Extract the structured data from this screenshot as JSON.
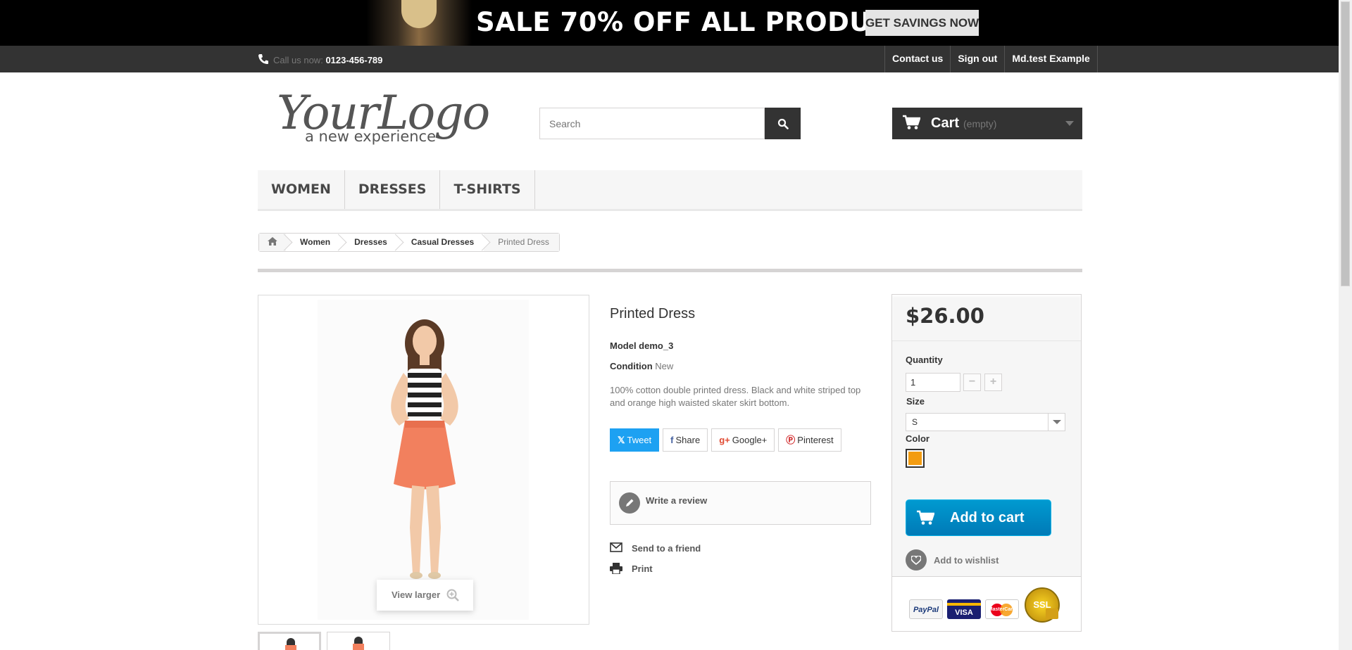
{
  "banner": {
    "headline": "SALE 70% OFF ALL PRODUCTS",
    "cta": "GET SAVINGS NOW"
  },
  "topbar": {
    "call_label": "Call us now:",
    "phone": "0123-456-789",
    "links": [
      "Contact us",
      "Sign out",
      "Md.test Example"
    ]
  },
  "logo": {
    "main": "YourLogo",
    "tagline": "a new experience"
  },
  "search": {
    "placeholder": "Search"
  },
  "cart": {
    "label": "Cart",
    "status": "(empty)"
  },
  "menu": [
    "WOMEN",
    "DRESSES",
    "T-SHIRTS"
  ],
  "breadcrumb": [
    "Women",
    "Dresses",
    "Casual Dresses",
    "Printed Dress"
  ],
  "product": {
    "title": "Printed Dress",
    "model": "Model demo_3",
    "condition_label": "Condition",
    "condition_value": "New",
    "description": "100% cotton double printed dress. Black and white striped top and orange high waisted skater skirt bottom.",
    "view_larger": "View larger"
  },
  "social": {
    "tweet": "Tweet",
    "share": "Share",
    "google": "Google+",
    "pinterest": "Pinterest"
  },
  "actions": {
    "write_review": "Write a review",
    "send_friend": "Send to a friend",
    "print": "Print"
  },
  "buybox": {
    "price": "$26.00",
    "quantity_label": "Quantity",
    "quantity_value": "1",
    "size_label": "Size",
    "size_value": "S",
    "color_label": "Color",
    "color_swatch": "#f39c11",
    "add_to_cart": "Add to cart",
    "wishlist": "Add to wishlist"
  },
  "payment": {
    "paypal": "PayPal",
    "visa": "VISA",
    "mastercard": "MasterCard",
    "ssl": "SSL"
  },
  "colors": {
    "dark": "#333333",
    "accent_blue": "#009ad0",
    "tweet_blue": "#1da1f2"
  }
}
